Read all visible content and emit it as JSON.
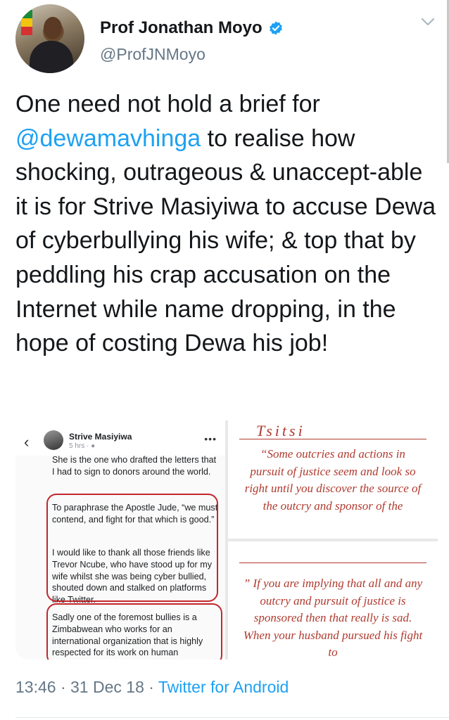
{
  "author": {
    "name": "Prof Jonathan Moyo",
    "handle": "@ProfJNMoyo",
    "verified": true,
    "verified_icon": "verified-badge-icon",
    "menu_icon": "chevron-down-icon"
  },
  "tweet": {
    "text_before_mention": "One need not hold a brief for ",
    "mention": "@dewamavhinga",
    "text_after_mention": " to realise how shocking, outrageous & unaccept-able it is for Strive Masiyiwa to accuse Dewa of cyberbullying his wife; & top that by peddling his crap accusation on the Internet while name dropping, in the  hope of costing Dewa his job!",
    "time": "13:46",
    "separator1": " · ",
    "date": "31 Dec 18",
    "separator2": " · ",
    "source": "Twitter for Android"
  },
  "media": {
    "left_image": {
      "poster_name": "Strive Masiyiwa",
      "poster_time": "5 hrs · ",
      "paragraphs": [
        "She is the one who drafted the letters that I had to sign to donors around the world.",
        "To paraphrase the Apostle Jude, “we must contend, and fight for that which is good.”",
        "I would like to thank all those friends like Trevor Ncube, who have stood up for my wife whilst she was being cyber bullied, shouted down and stalked on platforms like Twitter.",
        "Sadly one of the foremost bullies is a Zimbabwean who works for an international organization that is highly respected for its work on human"
      ]
    },
    "right_top_image": {
      "signature": "Tsitsi",
      "quote": "“Some outcries and actions in pursuit of justice seem and look so right until you discover the source of the outcry and sponsor of the"
    },
    "right_bottom_image": {
      "quote": "” If you are implying that all and any outcry and pursuit of justice is sponsored then that really is sad. When your husband pursued his fight to"
    }
  },
  "colors": {
    "link": "#1da1f2",
    "meta": "#657786",
    "text": "#14171a",
    "ink": "#c1272d"
  }
}
